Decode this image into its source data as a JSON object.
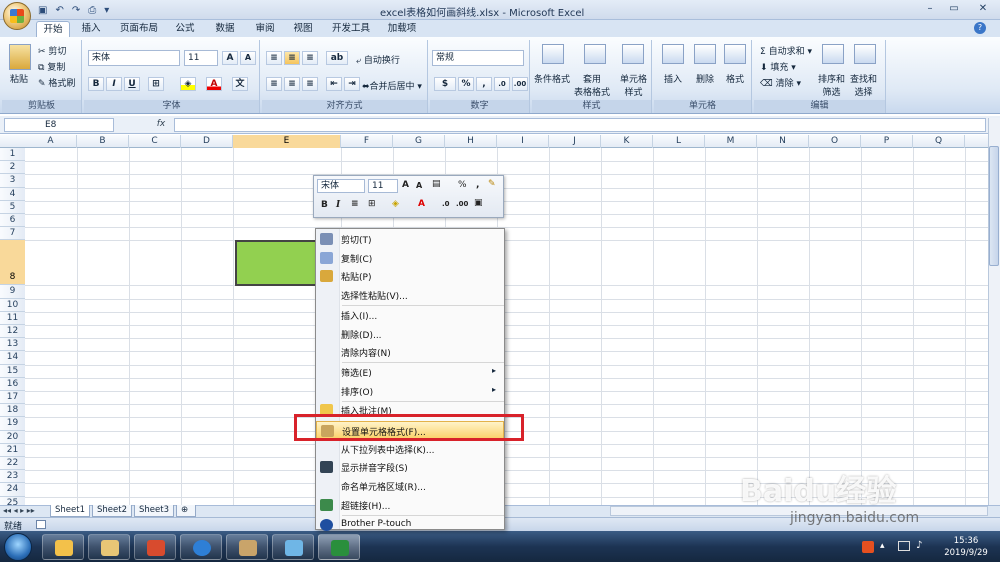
{
  "window": {
    "title": "excel表格如何画斜线.xlsx - Microsoft Excel"
  },
  "tabs": [
    "开始",
    "插入",
    "页面布局",
    "公式",
    "数据",
    "审阅",
    "视图",
    "开发工具",
    "加载项"
  ],
  "ribbon": {
    "clipboard": {
      "paste": "粘贴",
      "cut": "剪切",
      "copy": "复制",
      "format_painter": "格式刷",
      "label": "剪贴板"
    },
    "font": {
      "name": "宋体",
      "size": "11",
      "bold": "B",
      "italic": "I",
      "underline": "U",
      "label": "字体"
    },
    "alignment": {
      "wrap": "自动换行",
      "merge": "合并后居中",
      "label": "对齐方式"
    },
    "number": {
      "format": "常规",
      "percent": "%",
      "comma": ",",
      "label": "数字"
    },
    "styles": {
      "conditional": "条件格式",
      "table": "套用\n表格格式",
      "cell_styles": "单元格\n样式",
      "label": "样式"
    },
    "cells": {
      "insert": "插入",
      "delete": "删除",
      "format": "格式",
      "label": "单元格"
    },
    "editing": {
      "autosum": "自动求和",
      "fill": "填充",
      "clear": "清除",
      "sort": "排序和\n筛选",
      "find": "查找和\n选择",
      "label": "编辑"
    }
  },
  "formula_bar": {
    "name_box": "E8",
    "fx": "fx",
    "value": ""
  },
  "grid": {
    "columns": [
      "A",
      "B",
      "C",
      "D",
      "E",
      "F",
      "G",
      "H",
      "I",
      "J",
      "K",
      "L",
      "M",
      "N",
      "O",
      "P",
      "Q"
    ],
    "rows": [
      "1",
      "2",
      "3",
      "4",
      "5",
      "6",
      "7",
      "8",
      "9",
      "10",
      "11",
      "12",
      "13",
      "14",
      "15",
      "16",
      "17",
      "18",
      "19",
      "20",
      "21",
      "22",
      "23",
      "24",
      "25"
    ],
    "selected_col": "E",
    "selected_row": "8",
    "cell_fill": "#92d050"
  },
  "mini_toolbar": {
    "font": "宋体",
    "size": "11",
    "percent": "%",
    "comma": ",",
    "bold": "B",
    "italic": "I"
  },
  "context_menu": [
    {
      "label": "剪切(T)",
      "icon": "scissors-icon"
    },
    {
      "label": "复制(C)",
      "icon": "copy-icon"
    },
    {
      "label": "粘贴(P)",
      "icon": "paste-icon"
    },
    {
      "label": "选择性粘贴(V)...",
      "icon": ""
    },
    {
      "label": "插入(I)...",
      "icon": ""
    },
    {
      "label": "删除(D)...",
      "icon": ""
    },
    {
      "label": "清除内容(N)",
      "icon": ""
    },
    {
      "label": "筛选(E)",
      "icon": "",
      "submenu": true
    },
    {
      "label": "排序(O)",
      "icon": "",
      "submenu": true
    },
    {
      "label": "插入批注(M)",
      "icon": "comment-icon"
    },
    {
      "label": "设置单元格格式(F)...",
      "icon": "format-cells-icon",
      "highlighted": true
    },
    {
      "label": "从下拉列表中选择(K)...",
      "icon": ""
    },
    {
      "label": "显示拼音字段(S)",
      "icon": "phonetic-icon"
    },
    {
      "label": "命名单元格区域(R)...",
      "icon": ""
    },
    {
      "label": "超链接(H)...",
      "icon": "hyperlink-icon"
    },
    {
      "label": "Brother P-touch",
      "icon": "brother-icon"
    }
  ],
  "sheets": [
    "Sheet1",
    "Sheet2",
    "Sheet3"
  ],
  "status": {
    "text": "就绪"
  },
  "clock": {
    "time": "15:36",
    "date": "2019/9/29"
  },
  "watermark": {
    "brand": "Baidu经验",
    "url": "jingyan.baidu.com"
  }
}
